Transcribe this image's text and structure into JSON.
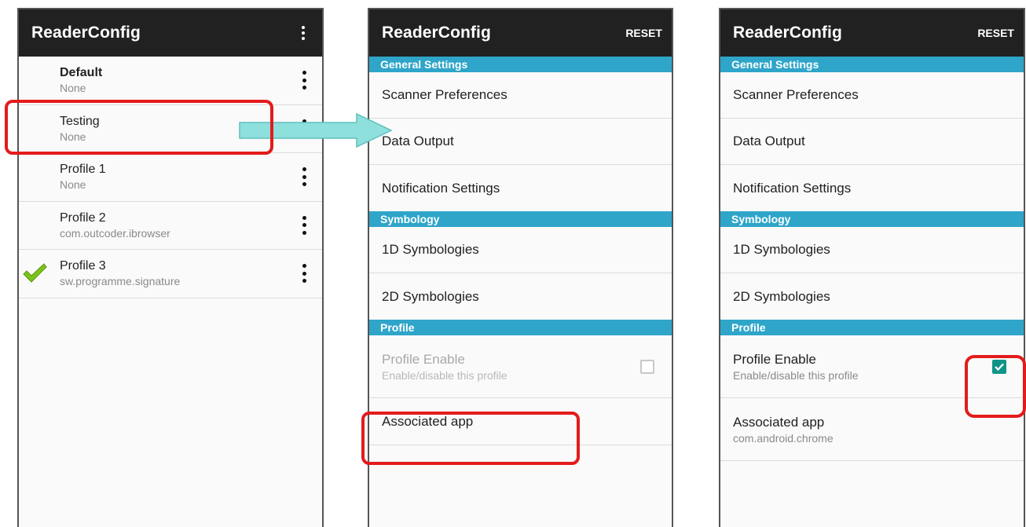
{
  "screen1": {
    "title": "ReaderConfig",
    "profiles": [
      {
        "name": "Default",
        "sub": "None"
      },
      {
        "name": "Testing",
        "sub": "None"
      },
      {
        "name": "Profile 1",
        "sub": "None"
      },
      {
        "name": "Profile 2",
        "sub": "com.outcoder.ibrowser"
      },
      {
        "name": "Profile 3",
        "sub": "sw.programme.signature",
        "active": true
      }
    ]
  },
  "screen2": {
    "title": "ReaderConfig",
    "reset_label": "RESET",
    "sections": {
      "general": "General Settings",
      "symbology": "Symbology",
      "profile": "Profile"
    },
    "items": {
      "scanner_prefs": "Scanner Preferences",
      "data_output": "Data Output",
      "notification": "Notification Settings",
      "sym_1d": "1D Symbologies",
      "sym_2d": "2D Symbologies",
      "profile_enable": "Profile Enable",
      "profile_enable_sub": "Enable/disable this profile",
      "associated_app": "Associated app"
    },
    "profile_enabled": false
  },
  "screen3": {
    "title": "ReaderConfig",
    "reset_label": "RESET",
    "sections": {
      "general": "General Settings",
      "symbology": "Symbology",
      "profile": "Profile"
    },
    "items": {
      "scanner_prefs": "Scanner Preferences",
      "data_output": "Data Output",
      "notification": "Notification Settings",
      "sym_1d": "1D Symbologies",
      "sym_2d": "2D Symbologies",
      "profile_enable": "Profile Enable",
      "profile_enable_sub": "Enable/disable this profile",
      "associated_app": "Associated app",
      "associated_app_value": "com.android.chrome"
    },
    "profile_enabled": true
  },
  "colors": {
    "appbar": "#212121",
    "section_header": "#2fa5c9",
    "checkbox_checked": "#109488",
    "annotation_red": "#e41b1b",
    "annotation_arrow": "#8ee0dc",
    "active_check": "#7cc21b"
  }
}
